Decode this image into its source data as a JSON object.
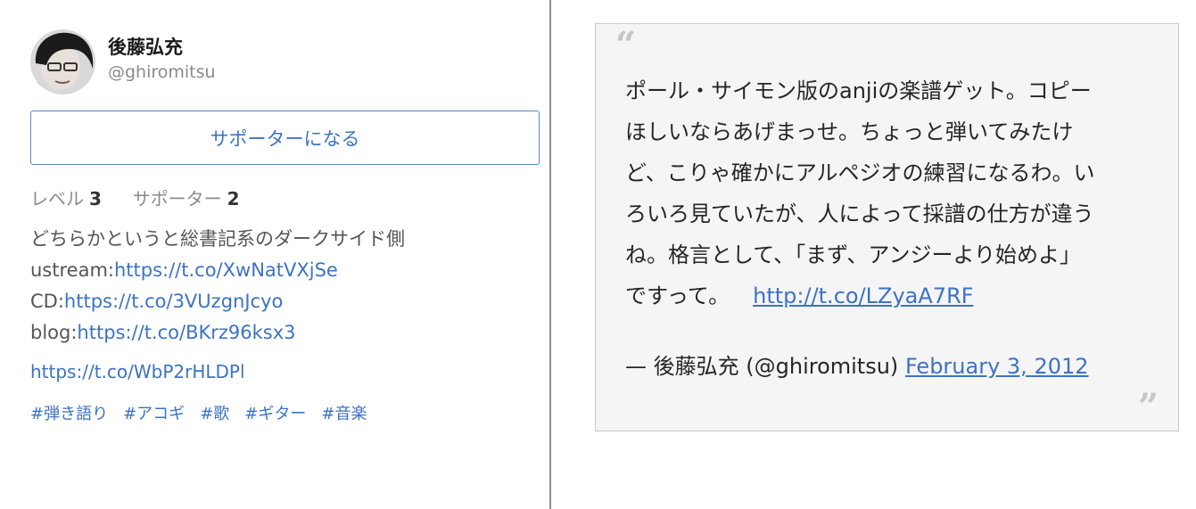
{
  "profile": {
    "name": "後藤弘充",
    "handle": "@ghiromitsu",
    "support_button": "サポーターになる",
    "level_label": "レベル",
    "level_value": "3",
    "supporters_label": "サポーター",
    "supporters_value": "2",
    "bio_line1": "どちらかというと総書記系のダークサイド側",
    "bio_line2_prefix": "ustream:",
    "bio_line2_link": "https://t.co/XwNatVXjSe",
    "bio_line3_prefix": "CD:",
    "bio_line3_link": "https://t.co/3VUzgnJcyo",
    "bio_line4_prefix": "blog:",
    "bio_line4_link": "https://t.co/BKrz96ksx3",
    "link": "https://t.co/WbP2rHLDPl",
    "tags": [
      "#弾き語り",
      "#アコギ",
      "#歌",
      "#ギター",
      "#音楽"
    ]
  },
  "tweet": {
    "open_quote": "“",
    "close_quote": "”",
    "lines": [
      "ポール・サイモン版のanjiの楽譜ゲット。コピー",
      "ほしいならあげまっせ。ちょっと弾いてみたけ",
      "ど、こりゃ確かにアルペジオの練習になるわ。い",
      "ろいろ見ていたが、人によって採譜の仕方が違う",
      "ね。格言として、「まず、アンジーより始めよ」",
      "ですって。"
    ],
    "link": "http://t.co/LZyaA7RF",
    "attribution_prefix": "— 後藤弘充 (@ghiromitsu)",
    "date": "February 3, 2012"
  },
  "colors": {
    "link": "#3c73c4",
    "button_border": "#5a86c8",
    "card_bg": "#f5f5f5",
    "divider": "#8f8f8f"
  }
}
